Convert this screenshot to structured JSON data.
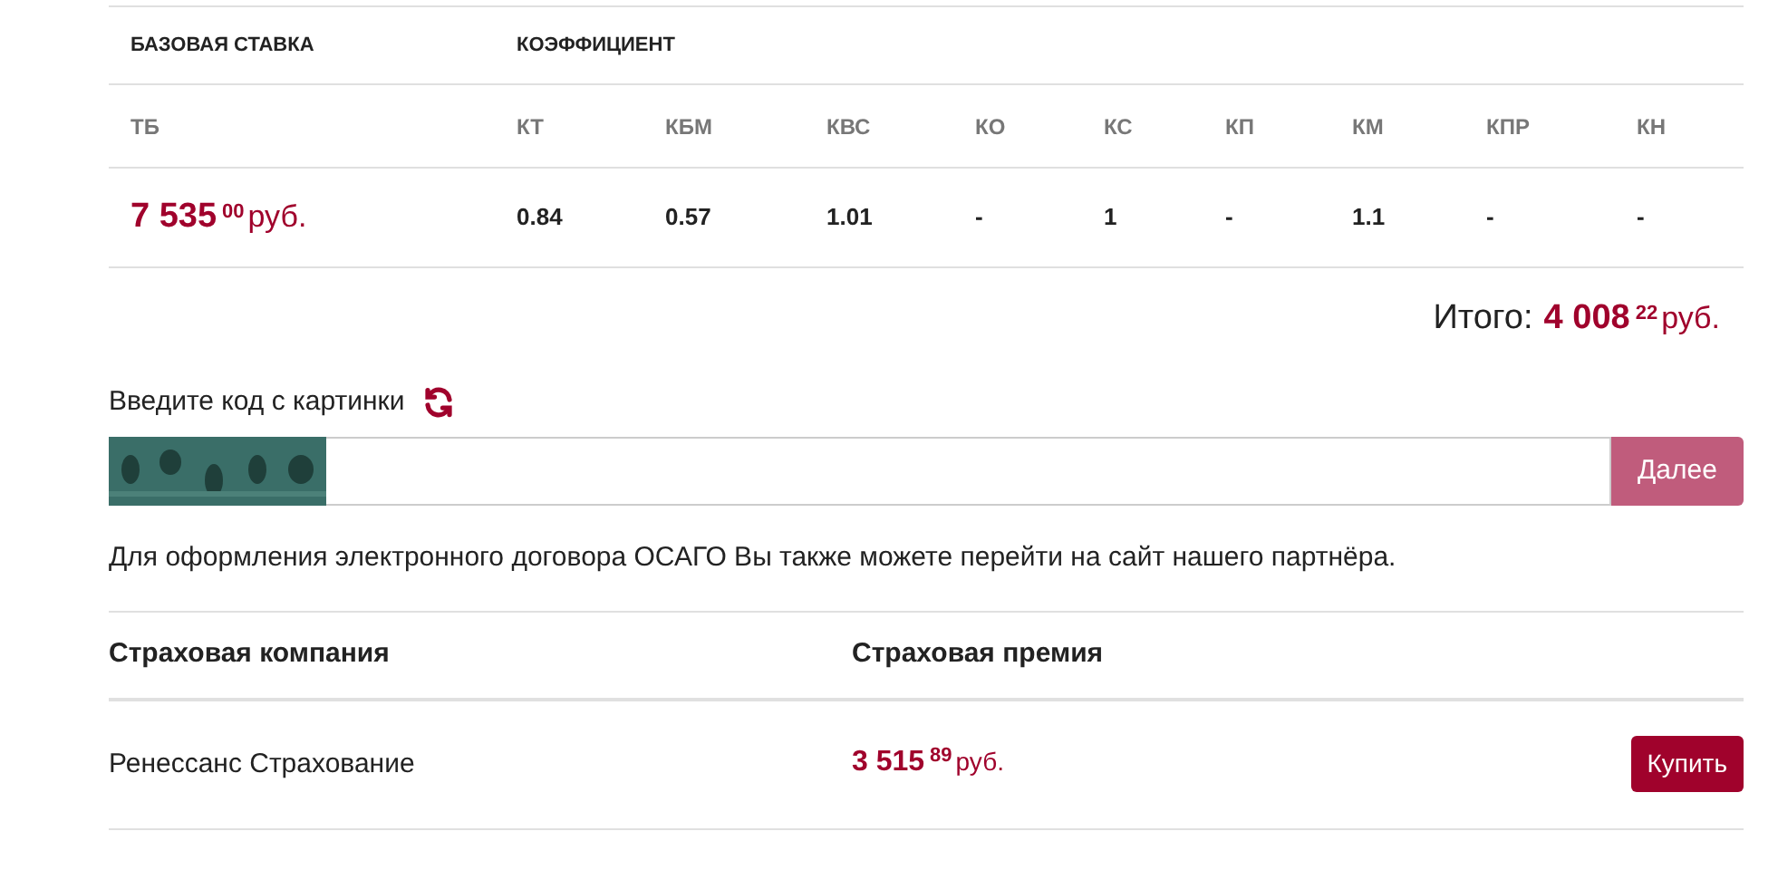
{
  "rate_table": {
    "group_headers": [
      "БАЗОВАЯ СТАВКА",
      "КОЭФФИЦИЕНТ"
    ],
    "columns": [
      "ТБ",
      "КТ",
      "КБМ",
      "КВС",
      "КО",
      "КС",
      "КП",
      "КМ",
      "КПР",
      "КН"
    ],
    "base_rate": {
      "main": "7 535",
      "cents": "00",
      "currency": "руб."
    },
    "values": [
      "0.84",
      "0.57",
      "1.01",
      "-",
      "1",
      "-",
      "1.1",
      "-",
      "-"
    ]
  },
  "total": {
    "label": "Итого:",
    "main": "4 008",
    "cents": "22",
    "currency": "руб."
  },
  "captcha": {
    "label": "Введите код с картинки",
    "button": "Далее"
  },
  "partner_note": "Для оформления электронного договора ОСАГО Вы также можете перейти на сайт нашего партнёра.",
  "offers": {
    "columns": [
      "Страховая компания",
      "Страховая премия"
    ],
    "rows": [
      {
        "company": "Ренессанс Страхование",
        "main": "3 515",
        "cents": "89",
        "currency": "руб.",
        "button": "Купить"
      }
    ]
  }
}
